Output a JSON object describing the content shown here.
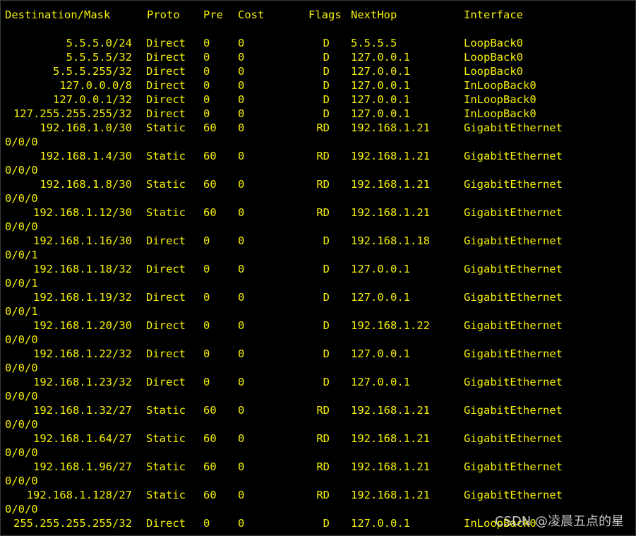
{
  "header": {
    "destination": "Destination/Mask",
    "proto": "Proto",
    "pre": "Pre",
    "cost": "Cost",
    "flags": "Flags",
    "nexthop": "NextHop",
    "interface": "Interface"
  },
  "routes": [
    {
      "dest": "5.5.5.0/24",
      "proto": "Direct",
      "pre": "0",
      "cost": "0",
      "flags": "D",
      "nexthop": "5.5.5.5",
      "iface": "LoopBack0",
      "wrap": ""
    },
    {
      "dest": "5.5.5.5/32",
      "proto": "Direct",
      "pre": "0",
      "cost": "0",
      "flags": "D",
      "nexthop": "127.0.0.1",
      "iface": "LoopBack0",
      "wrap": ""
    },
    {
      "dest": "5.5.5.255/32",
      "proto": "Direct",
      "pre": "0",
      "cost": "0",
      "flags": "D",
      "nexthop": "127.0.0.1",
      "iface": "LoopBack0",
      "wrap": ""
    },
    {
      "dest": "127.0.0.0/8",
      "proto": "Direct",
      "pre": "0",
      "cost": "0",
      "flags": "D",
      "nexthop": "127.0.0.1",
      "iface": "InLoopBack0",
      "wrap": ""
    },
    {
      "dest": "127.0.0.1/32",
      "proto": "Direct",
      "pre": "0",
      "cost": "0",
      "flags": "D",
      "nexthop": "127.0.0.1",
      "iface": "InLoopBack0",
      "wrap": ""
    },
    {
      "dest": "127.255.255.255/32",
      "proto": "Direct",
      "pre": "0",
      "cost": "0",
      "flags": "D",
      "nexthop": "127.0.0.1",
      "iface": "InLoopBack0",
      "wrap": ""
    },
    {
      "dest": "192.168.1.0/30",
      "proto": "Static",
      "pre": "60",
      "cost": "0",
      "flags": "RD",
      "nexthop": "192.168.1.21",
      "iface": "GigabitEthernet",
      "wrap": "0/0/0"
    },
    {
      "dest": "192.168.1.4/30",
      "proto": "Static",
      "pre": "60",
      "cost": "0",
      "flags": "RD",
      "nexthop": "192.168.1.21",
      "iface": "GigabitEthernet",
      "wrap": "0/0/0"
    },
    {
      "dest": "192.168.1.8/30",
      "proto": "Static",
      "pre": "60",
      "cost": "0",
      "flags": "RD",
      "nexthop": "192.168.1.21",
      "iface": "GigabitEthernet",
      "wrap": "0/0/0"
    },
    {
      "dest": "192.168.1.12/30",
      "proto": "Static",
      "pre": "60",
      "cost": "0",
      "flags": "RD",
      "nexthop": "192.168.1.21",
      "iface": "GigabitEthernet",
      "wrap": "0/0/0"
    },
    {
      "dest": "192.168.1.16/30",
      "proto": "Direct",
      "pre": "0",
      "cost": "0",
      "flags": "D",
      "nexthop": "192.168.1.18",
      "iface": "GigabitEthernet",
      "wrap": "0/0/1"
    },
    {
      "dest": "192.168.1.18/32",
      "proto": "Direct",
      "pre": "0",
      "cost": "0",
      "flags": "D",
      "nexthop": "127.0.0.1",
      "iface": "GigabitEthernet",
      "wrap": "0/0/1"
    },
    {
      "dest": "192.168.1.19/32",
      "proto": "Direct",
      "pre": "0",
      "cost": "0",
      "flags": "D",
      "nexthop": "127.0.0.1",
      "iface": "GigabitEthernet",
      "wrap": "0/0/1"
    },
    {
      "dest": "192.168.1.20/30",
      "proto": "Direct",
      "pre": "0",
      "cost": "0",
      "flags": "D",
      "nexthop": "192.168.1.22",
      "iface": "GigabitEthernet",
      "wrap": "0/0/0"
    },
    {
      "dest": "192.168.1.22/32",
      "proto": "Direct",
      "pre": "0",
      "cost": "0",
      "flags": "D",
      "nexthop": "127.0.0.1",
      "iface": "GigabitEthernet",
      "wrap": "0/0/0"
    },
    {
      "dest": "192.168.1.23/32",
      "proto": "Direct",
      "pre": "0",
      "cost": "0",
      "flags": "D",
      "nexthop": "127.0.0.1",
      "iface": "GigabitEthernet",
      "wrap": "0/0/0"
    },
    {
      "dest": "192.168.1.32/27",
      "proto": "Static",
      "pre": "60",
      "cost": "0",
      "flags": "RD",
      "nexthop": "192.168.1.21",
      "iface": "GigabitEthernet",
      "wrap": "0/0/0"
    },
    {
      "dest": "192.168.1.64/27",
      "proto": "Static",
      "pre": "60",
      "cost": "0",
      "flags": "RD",
      "nexthop": "192.168.1.21",
      "iface": "GigabitEthernet",
      "wrap": "0/0/0"
    },
    {
      "dest": "192.168.1.96/27",
      "proto": "Static",
      "pre": "60",
      "cost": "0",
      "flags": "RD",
      "nexthop": "192.168.1.21",
      "iface": "GigabitEthernet",
      "wrap": "0/0/0"
    },
    {
      "dest": "192.168.1.128/27",
      "proto": "Static",
      "pre": "60",
      "cost": "0",
      "flags": "RD",
      "nexthop": "192.168.1.21",
      "iface": "GigabitEthernet",
      "wrap": "0/0/0"
    },
    {
      "dest": "255.255.255.255/32",
      "proto": "Direct",
      "pre": "0",
      "cost": "0",
      "flags": "D",
      "nexthop": "127.0.0.1",
      "iface": "InLoopBack0",
      "wrap": ""
    }
  ],
  "watermark": "CSDN @凌晨五点的星",
  "colors": {
    "background": "#000000",
    "text": "#f5f00a",
    "watermark": "#e8e8e8"
  }
}
